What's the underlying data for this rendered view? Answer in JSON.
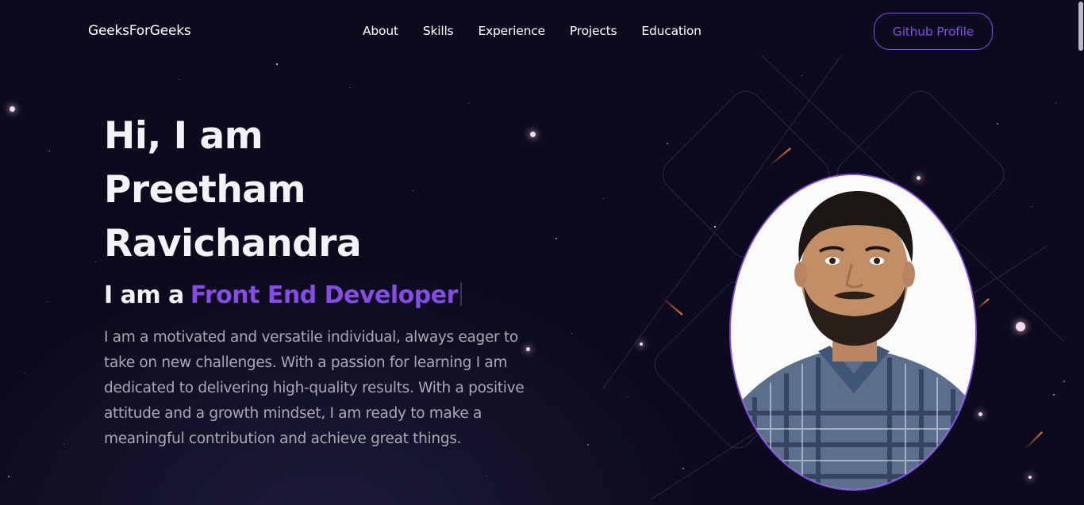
{
  "navbar": {
    "logo": "GeeksForGeeks",
    "links": [
      "About",
      "Skills",
      "Experience",
      "Projects",
      "Education"
    ],
    "github_button": "Github Profile"
  },
  "hero": {
    "title_lines": [
      "Hi, I am",
      "Preetham",
      "Ravichandra"
    ],
    "subtitle_prefix": "I am a",
    "subtitle_role": "Front End Developer",
    "description": "I am a motivated and versatile individual, always eager to take on new challenges. With a passion for learning I am dedicated to delivering high-quality results. With a positive attitude and a growth mindset, I am ready to make a meaningful contribution and achieve great things."
  },
  "colors": {
    "background": "#0c0b1d",
    "accent": "#854ce6",
    "text_primary": "#f2f3f4",
    "text_secondary": "#a9a9b5"
  },
  "icons": {
    "profile_photo": "profile-photo"
  }
}
